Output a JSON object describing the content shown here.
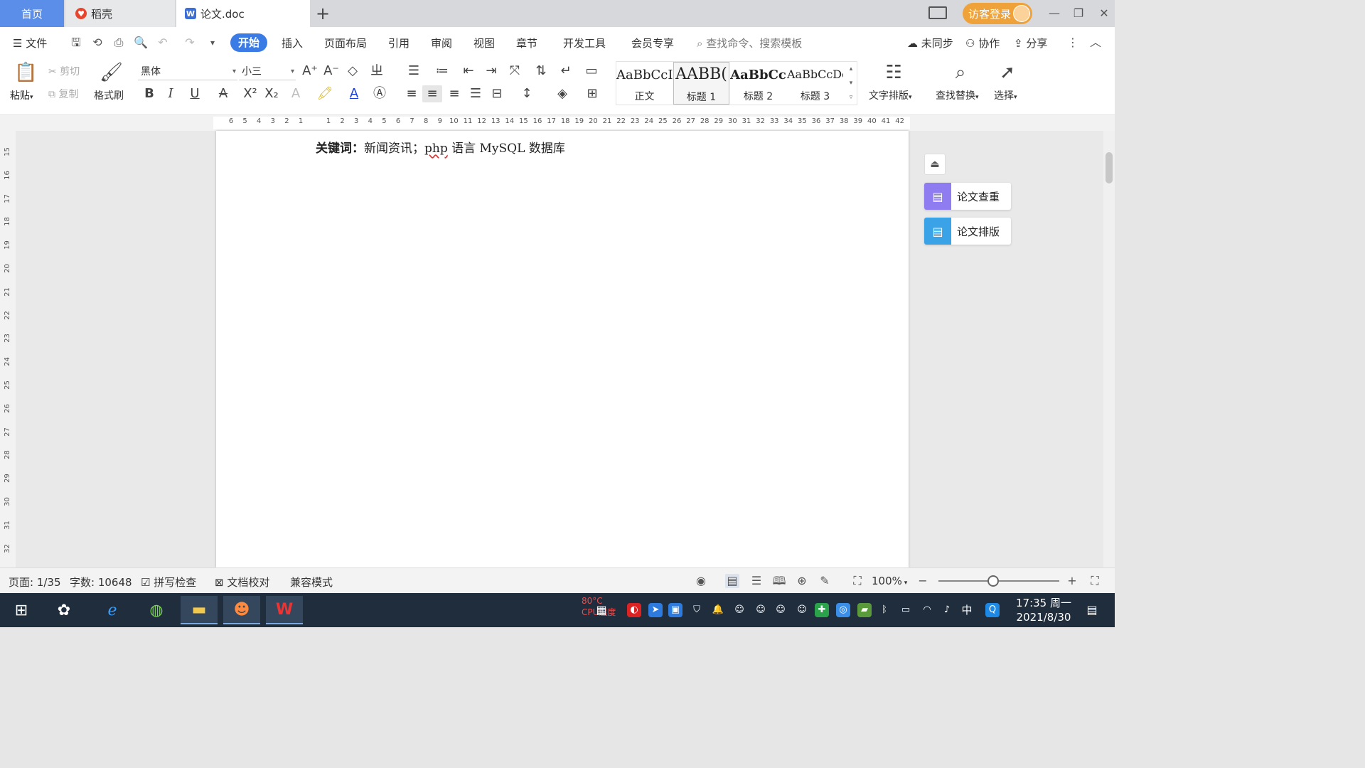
{
  "tabs": {
    "home": "首页",
    "daoke": "稻壳",
    "doc": "论文.doc",
    "new_tab": "+"
  },
  "titlebar": {
    "login": "访客登录",
    "minimize": "—",
    "restore": "❐",
    "close": "✕"
  },
  "menu": {
    "file": "文件",
    "items": [
      "开始",
      "插入",
      "页面布局",
      "引用",
      "审阅",
      "视图",
      "章节",
      "开发工具",
      "会员专享"
    ],
    "search_placeholder": "查找命令、搜索模板",
    "unsynced": "未同步",
    "collab": "协作",
    "share": "分享"
  },
  "ribbon": {
    "paste": "粘贴",
    "cut": "剪切",
    "copy": "复制",
    "format_painter": "格式刷",
    "font_name": "黑体",
    "font_size": "小三",
    "styles": [
      {
        "sample": "AaBbCcI",
        "name": "正文"
      },
      {
        "sample": "AABB(",
        "name": "标题 1"
      },
      {
        "sample": "AaBbCc",
        "name": "标题 2"
      },
      {
        "sample": "AaBbCcDc",
        "name": "标题 3"
      }
    ],
    "text_layout": "文字排版",
    "find_replace": "查找替换",
    "select": "选择"
  },
  "ruler": {
    "left_numbers": [
      "6",
      "5",
      "4",
      "3",
      "2",
      "1"
    ],
    "right_numbers": [
      "1",
      "2",
      "3",
      "4",
      "5",
      "6",
      "7",
      "8",
      "9",
      "10",
      "11",
      "12",
      "13",
      "14",
      "15",
      "16",
      "17",
      "18",
      "19",
      "20",
      "21",
      "22",
      "23",
      "24",
      "25",
      "26",
      "27",
      "28",
      "29",
      "30",
      "31",
      "32",
      "33",
      "34",
      "35",
      "36",
      "37",
      "38",
      "39",
      "40",
      "41",
      "42"
    ],
    "vertical_numbers": [
      "15",
      "16",
      "17",
      "18",
      "19",
      "20",
      "21",
      "22",
      "23",
      "24",
      "25",
      "26",
      "27",
      "28",
      "29",
      "30",
      "31",
      "32"
    ]
  },
  "document": {
    "keyword_label": "关键词：",
    "keyword_pre": "新闻资讯；",
    "keyword_err": "php",
    "keyword_post": " 语言 MySQL 数据库"
  },
  "side_panel": {
    "check": "论文查重",
    "layout": "论文排版"
  },
  "status": {
    "page": "页面: 1/35",
    "words": "字数: 10648",
    "spell": "拼写检查",
    "proof": "文档校对",
    "compat": "兼容模式",
    "zoom": "100%",
    "zoom_level": 0.45
  },
  "taskbar": {
    "cpu_temp": "80°C",
    "cpu_label": "CPU温度",
    "ime": "中",
    "time": "17:35 周一",
    "date": "2021/8/30"
  },
  "colors": {
    "accent": "#3b7be6",
    "home_tab": "#5b8ee8",
    "login": "#f0a23a"
  }
}
